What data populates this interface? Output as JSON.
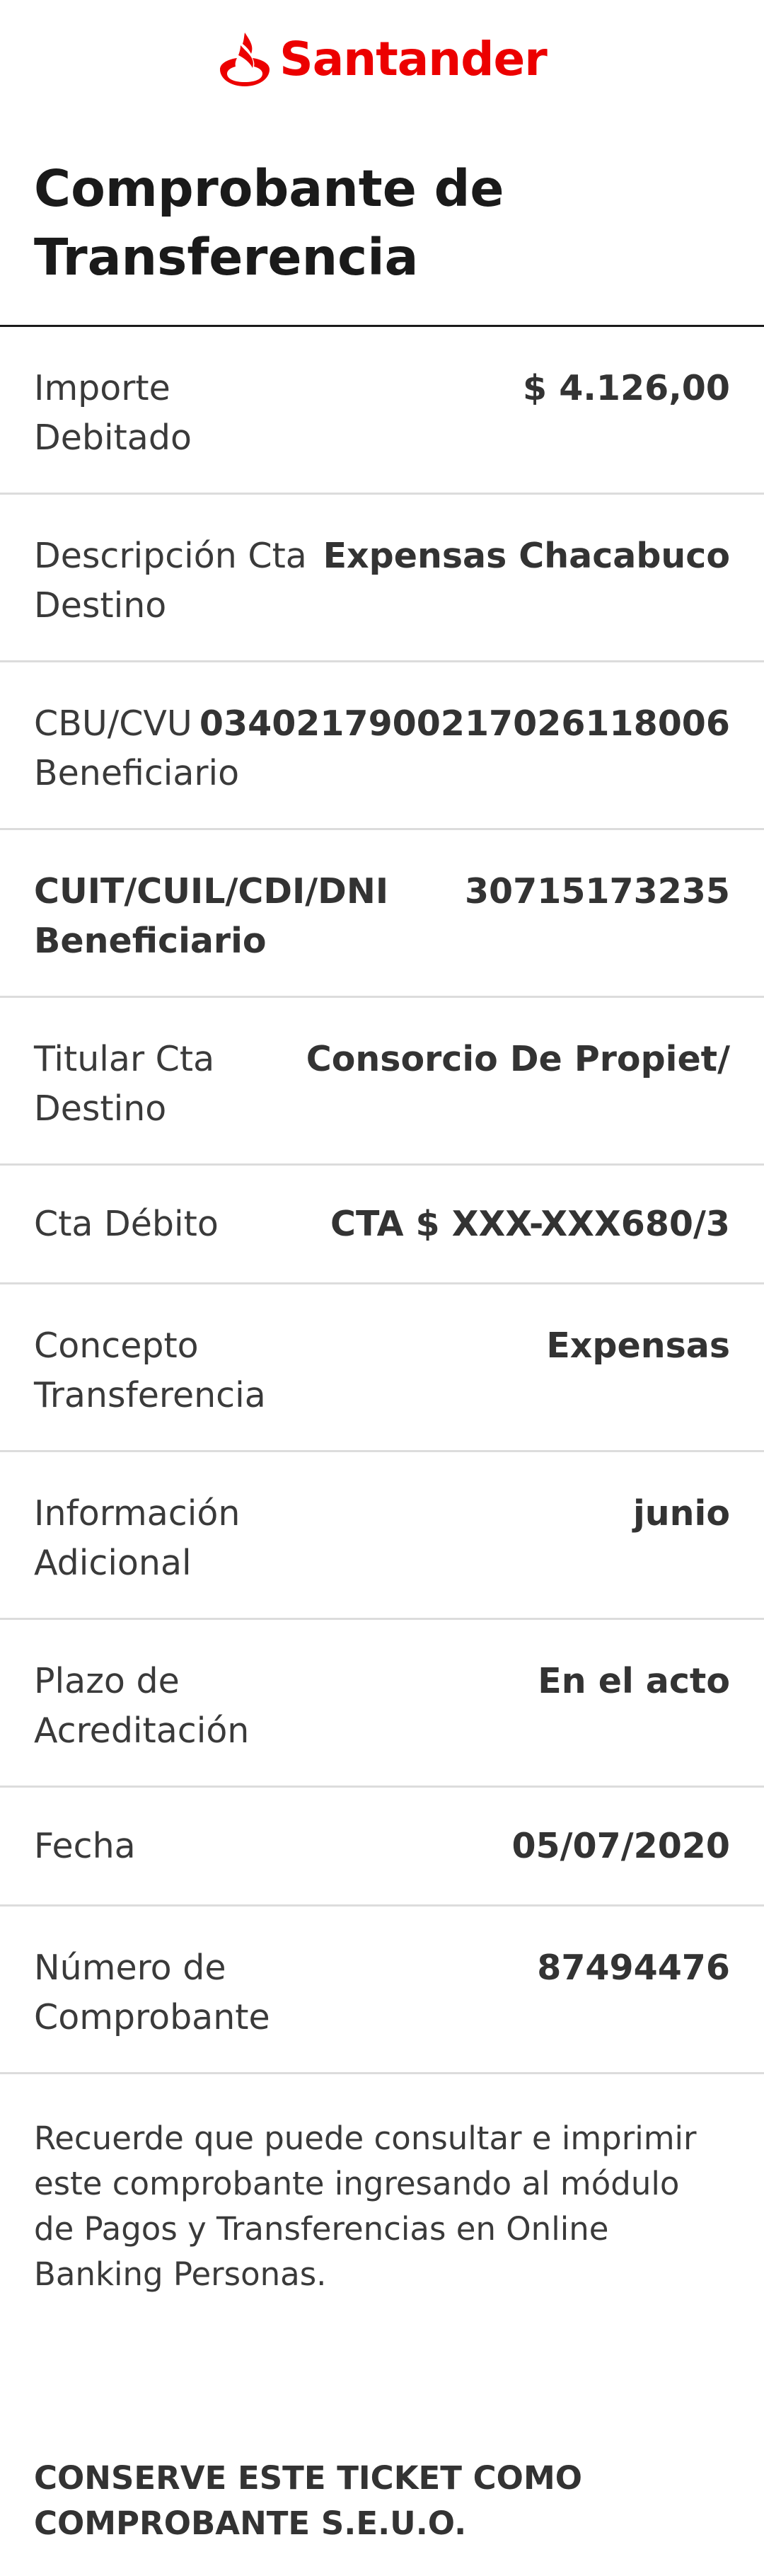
{
  "brand": {
    "name": "Santander",
    "color": "#ec0000",
    "logo_icon": "santander-flame-icon"
  },
  "title": "Comprobante de Transferencia",
  "rows": [
    {
      "label": "Importe Debitado",
      "value": "$ 4.126,00"
    },
    {
      "label": "Descripción Cta Destino",
      "value": "Expensas Chacabuco"
    },
    {
      "label": "CBU/CVU Beneficiario",
      "value": "0340217900217026118006"
    },
    {
      "label": "CUIT/CUIL/CDI/DNI Beneficiario",
      "value": "30715173235"
    },
    {
      "label": "Titular Cta Destino",
      "value": "Consorcio De Propiet/"
    },
    {
      "label": "Cta Débito",
      "value": "CTA $ XXX-XXX680/3"
    },
    {
      "label": "Concepto Transferencia",
      "value": "Expensas"
    },
    {
      "label": "Información Adicional",
      "value": "junio"
    },
    {
      "label": "Plazo de Acreditación",
      "value": "En el acto"
    },
    {
      "label": "Fecha",
      "value": "05/07/2020"
    },
    {
      "label": "Número de Comprobante",
      "value": "87494476"
    }
  ],
  "footer": {
    "note": "Recuerde que puede consultar e imprimir este comprobante ingresando al módulo de Pagos y Transferencias en Online Banking Personas.",
    "warning": "CONSERVE ESTE TICKET COMO COMPROBANTE S.E.U.O."
  }
}
